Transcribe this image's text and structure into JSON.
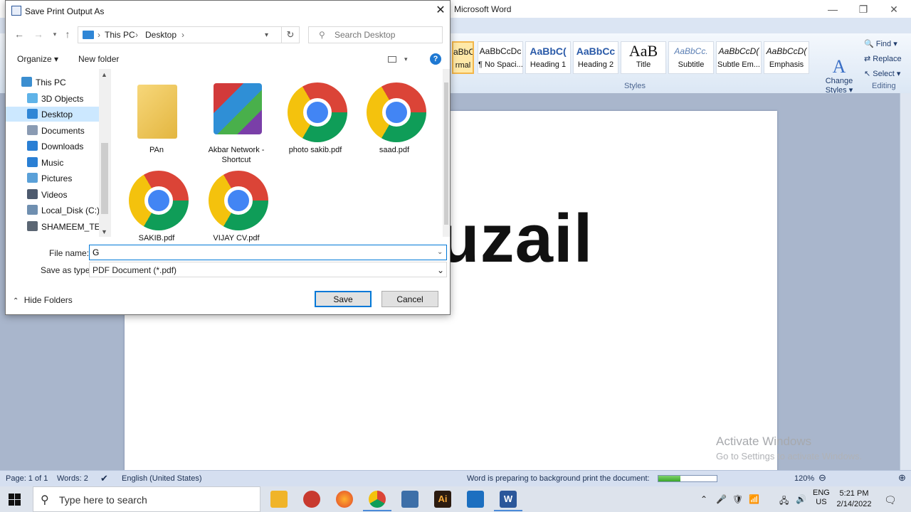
{
  "word": {
    "title": "Microsoft Word",
    "window_controls": {
      "minimize": "—",
      "restore": "❐",
      "close": "✕"
    },
    "styles": [
      {
        "preview": "aBbCcDc",
        "name": "rmal"
      },
      {
        "preview": "AaBbCcDc",
        "name": "¶ No Spaci..."
      },
      {
        "preview": "AaBbC(",
        "name": "Heading 1"
      },
      {
        "preview": "AaBbCc",
        "name": "Heading 2"
      },
      {
        "preview": "AaB",
        "name": "Title"
      },
      {
        "preview": "AaBbCc.",
        "name": "Subtitle"
      },
      {
        "preview": "AaBbCcD(",
        "name": "Subtle Em..."
      },
      {
        "preview": "AaBbCcD(",
        "name": "Emphasis"
      }
    ],
    "change_styles": {
      "line1": "Change",
      "line2": "Styles ▾"
    },
    "styles_group_label": "Styles",
    "editing": {
      "find": "Find ▾",
      "replace": "Replace",
      "select": "Select ▾",
      "label": "Editing"
    },
    "document_text": "uzail",
    "status": {
      "page": "Page: 1 of 1",
      "words": "Words: 2",
      "language": "English (United States)",
      "printing": "Word is preparing to background print the document:",
      "zoom": "120%",
      "progress": 0.38
    },
    "watermark": {
      "line1": "Activate Windows",
      "line2": "Go to Settings to activate Windows."
    }
  },
  "dialog": {
    "title": "Save Print Output As",
    "breadcrumb": [
      "This PC",
      "Desktop"
    ],
    "search_placeholder": "Search Desktop",
    "toolbar": {
      "organize": "Organize ▾",
      "new_folder": "New folder"
    },
    "nav_items": [
      {
        "label": "This PC",
        "color": "#3b8ed0"
      },
      {
        "label": "3D Objects",
        "color": "#5fb3e8"
      },
      {
        "label": "Desktop",
        "color": "#2f86d6"
      },
      {
        "label": "Documents",
        "color": "#8a9bb3"
      },
      {
        "label": "Downloads",
        "color": "#2a7fd4"
      },
      {
        "label": "Music",
        "color": "#2a7fd4"
      },
      {
        "label": "Pictures",
        "color": "#5aa0d8"
      },
      {
        "label": "Videos",
        "color": "#4d5a6e"
      },
      {
        "label": "Local_Disk (C:)",
        "color": "#6f8fb0"
      },
      {
        "label": "SHAMEEM_TELE",
        "color": "#5b6673"
      }
    ],
    "files": [
      {
        "name": "PAn",
        "kind": "folder"
      },
      {
        "name": "Akbar Network - Shortcut",
        "kind": "shortcut"
      },
      {
        "name": "photo sakib.pdf",
        "kind": "chrome"
      },
      {
        "name": "saad.pdf",
        "kind": "chrome"
      },
      {
        "name": "SAKIB.pdf",
        "kind": "chrome"
      },
      {
        "name": "VIJAY CV.pdf",
        "kind": "chrome"
      }
    ],
    "file_name_label": "File name:",
    "file_name_value": "G",
    "save_type_label": "Save as type:",
    "save_type_value": "PDF Document (*.pdf)",
    "hide_folders": "Hide Folders",
    "save_button": "Save",
    "cancel_button": "Cancel"
  },
  "taskbar": {
    "search_placeholder": "Type here to search",
    "language_line1": "ENG",
    "language_line2": "US",
    "time": "5:21 PM",
    "date": "2/14/2022"
  }
}
